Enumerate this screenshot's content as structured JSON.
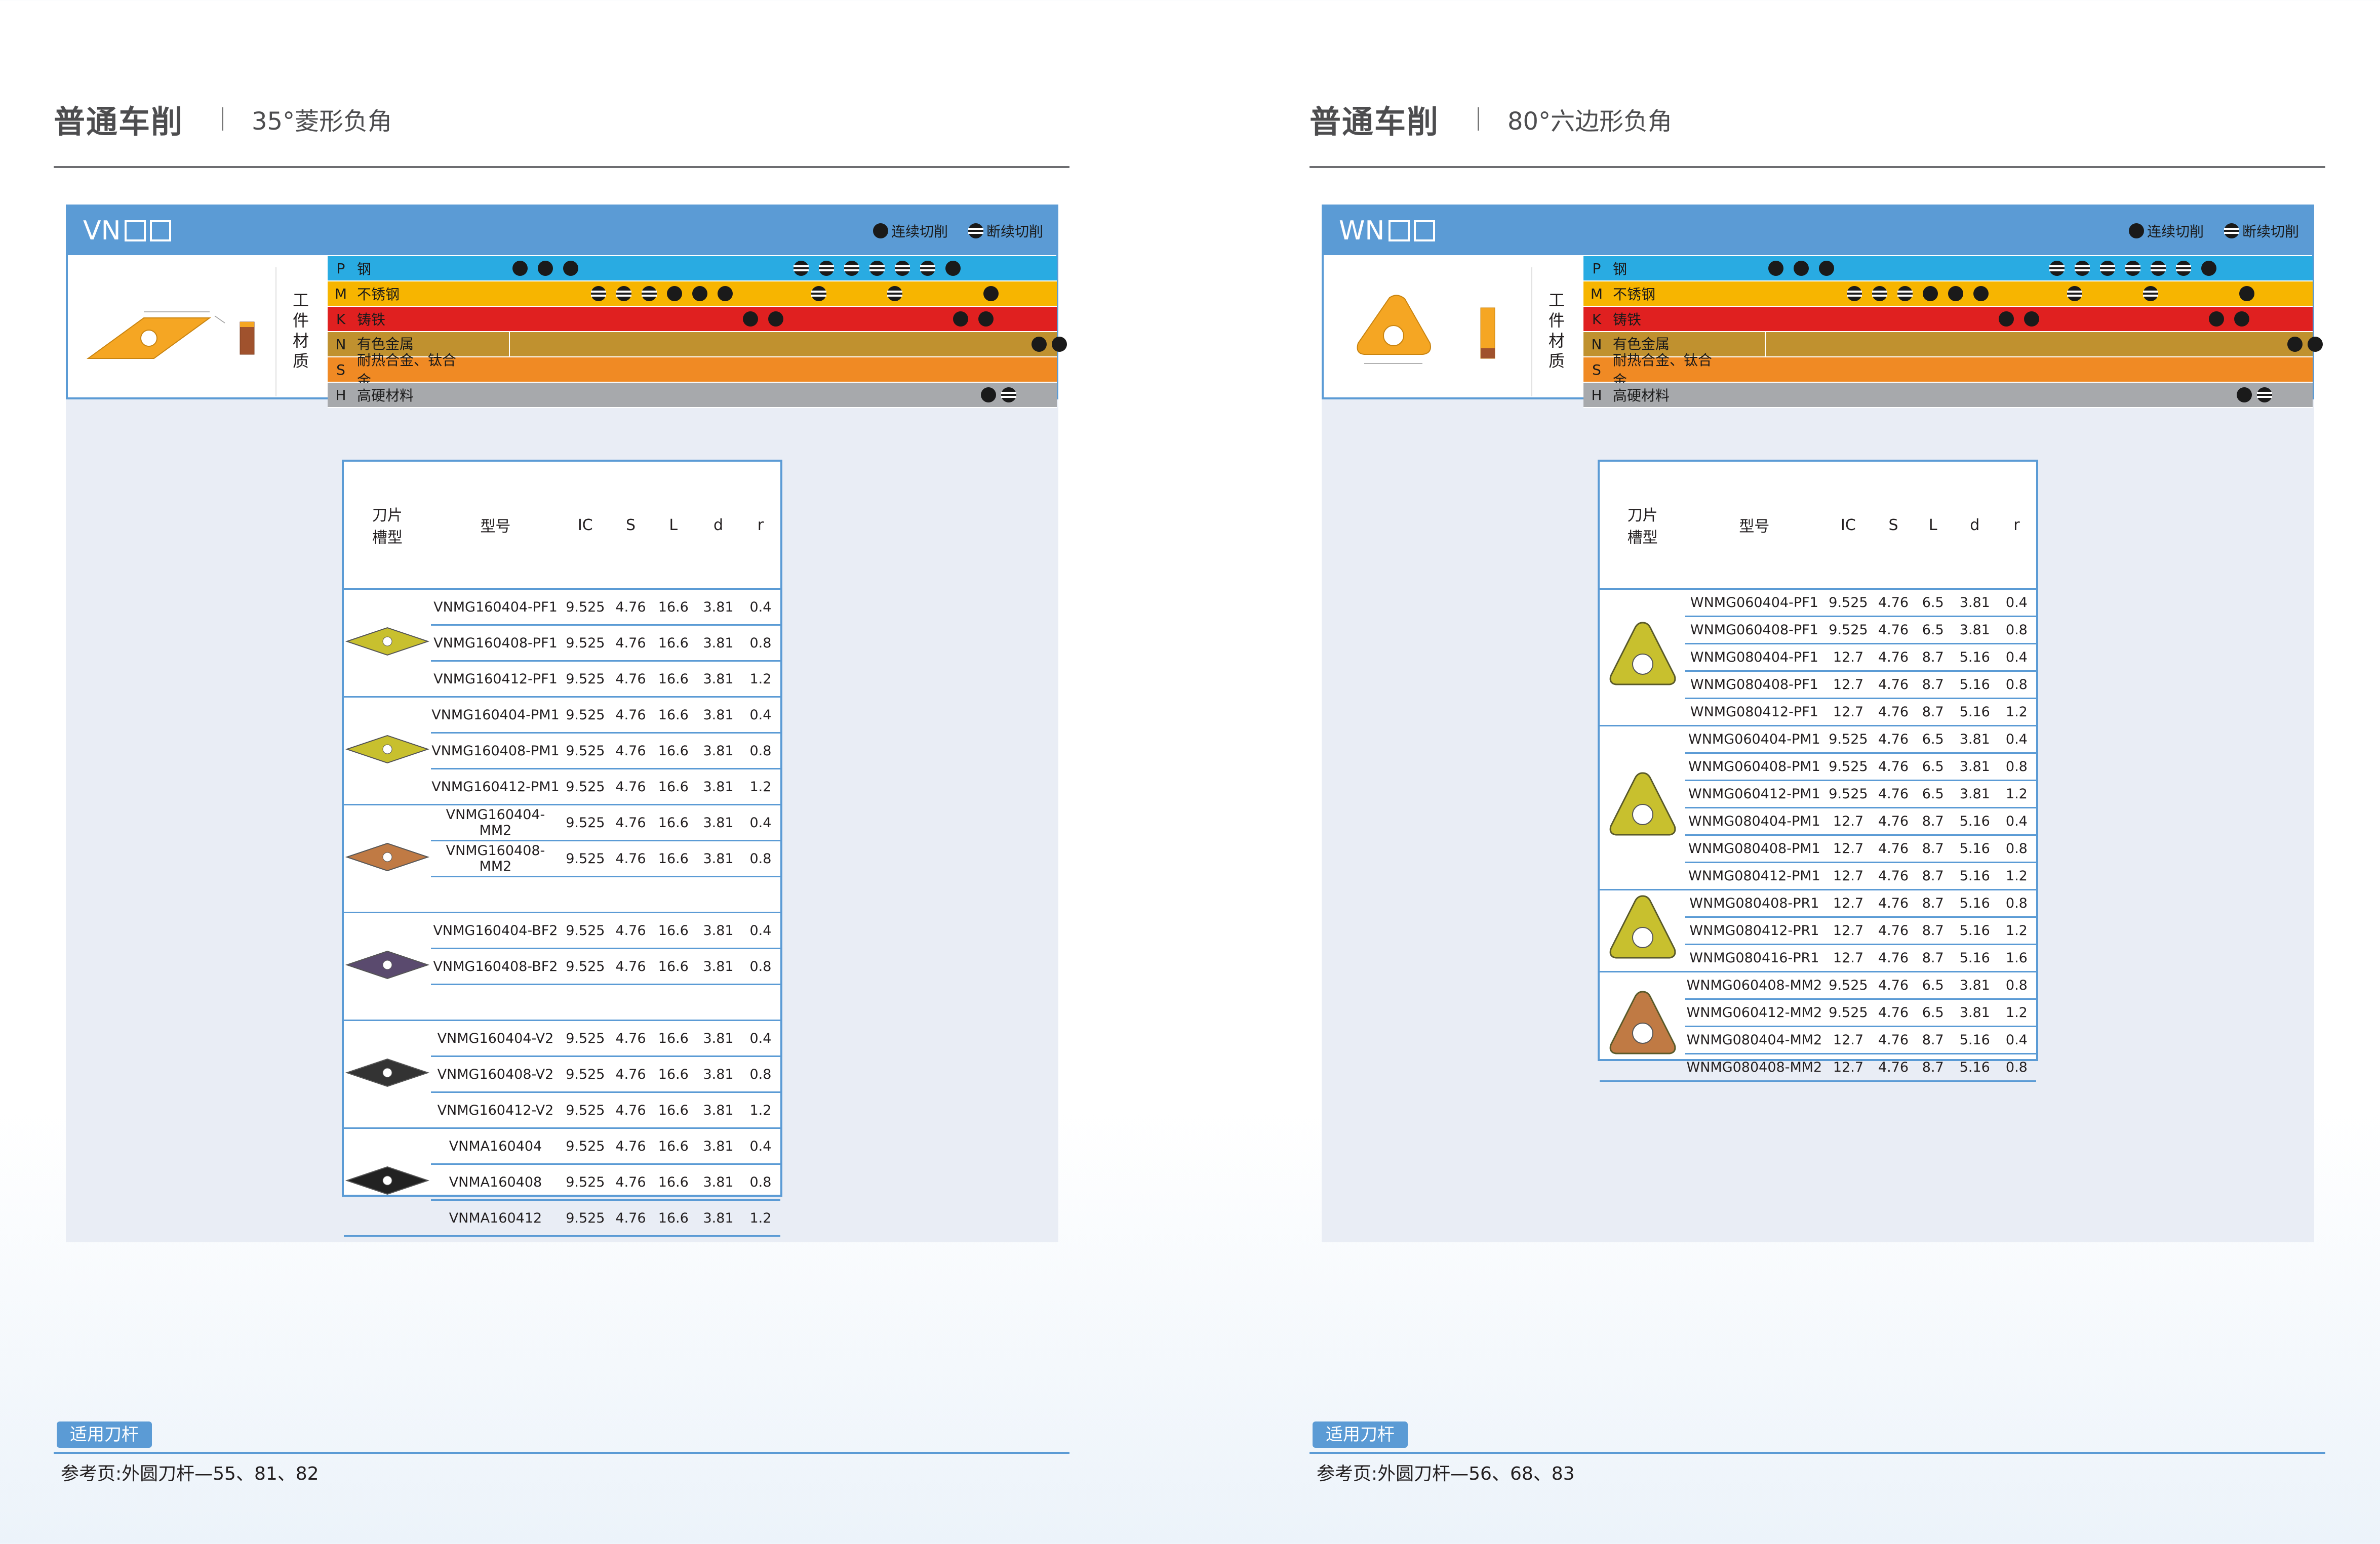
{
  "left": {
    "header": {
      "title": "普通车削",
      "subtitle": "35°菱形负角"
    },
    "code": "VN",
    "legend": {
      "continuous": "连续切削",
      "interrupted": "断续切削"
    },
    "side_label": "工件材质",
    "materials": [
      {
        "key": "P",
        "name": "钢",
        "color": "#29abe2"
      },
      {
        "key": "M",
        "name": "不锈钢",
        "color": "#f7b500"
      },
      {
        "key": "K",
        "name": "铸铁",
        "color": "#e02020"
      },
      {
        "key": "N",
        "name": "有色金属",
        "color": "#c0912f"
      },
      {
        "key": "S",
        "name": "耐热合金、钛合金",
        "color": "#f08a24"
      },
      {
        "key": "H",
        "name": "高硬材料",
        "color": "#a7a9ac"
      }
    ],
    "table": {
      "headers": {
        "groove": "刀片\n槽型",
        "model": "型号",
        "ic": "IC",
        "s": "S",
        "l": "L",
        "d": "d",
        "r": "r"
      },
      "groups": [
        {
          "insert_color": "#c8c02e",
          "rows": [
            [
              "VNMG160404-PF1",
              "9.525",
              "4.76",
              "16.6",
              "3.81",
              "0.4"
            ],
            [
              "VNMG160408-PF1",
              "9.525",
              "4.76",
              "16.6",
              "3.81",
              "0.8"
            ],
            [
              "VNMG160412-PF1",
              "9.525",
              "4.76",
              "16.6",
              "3.81",
              "1.2"
            ]
          ]
        },
        {
          "insert_color": "#c8c02e",
          "rows": [
            [
              "VNMG160404-PM1",
              "9.525",
              "4.76",
              "16.6",
              "3.81",
              "0.4"
            ],
            [
              "VNMG160408-PM1",
              "9.525",
              "4.76",
              "16.6",
              "3.81",
              "0.8"
            ],
            [
              "VNMG160412-PM1",
              "9.525",
              "4.76",
              "16.6",
              "3.81",
              "1.2"
            ]
          ]
        },
        {
          "insert_color": "#c07a44",
          "rows": [
            [
              "VNMG160404-MM2",
              "9.525",
              "4.76",
              "16.6",
              "3.81",
              "0.4"
            ],
            [
              "VNMG160408-MM2",
              "9.525",
              "4.76",
              "16.6",
              "3.81",
              "0.8"
            ],
            [
              "",
              "",
              "",
              "",
              "",
              ""
            ]
          ]
        },
        {
          "insert_color": "#5a4a6e",
          "rows": [
            [
              "VNMG160404-BF2",
              "9.525",
              "4.76",
              "16.6",
              "3.81",
              "0.4"
            ],
            [
              "VNMG160408-BF2",
              "9.525",
              "4.76",
              "16.6",
              "3.81",
              "0.8"
            ],
            [
              "",
              "",
              "",
              "",
              "",
              ""
            ]
          ]
        },
        {
          "insert_color": "#333333",
          "rows": [
            [
              "VNMG160404-V2",
              "9.525",
              "4.76",
              "16.6",
              "3.81",
              "0.4"
            ],
            [
              "VNMG160408-V2",
              "9.525",
              "4.76",
              "16.6",
              "3.81",
              "0.8"
            ],
            [
              "VNMG160412-V2",
              "9.525",
              "4.76",
              "16.6",
              "3.81",
              "1.2"
            ]
          ]
        },
        {
          "insert_color": "#222222",
          "rows": [
            [
              "VNMA160404",
              "9.525",
              "4.76",
              "16.6",
              "3.81",
              "0.4"
            ],
            [
              "VNMA160408",
              "9.525",
              "4.76",
              "16.6",
              "3.81",
              "0.8"
            ],
            [
              "VNMA160412",
              "9.525",
              "4.76",
              "16.6",
              "3.81",
              "1.2"
            ]
          ]
        }
      ]
    },
    "footer": {
      "button": "适用刀杆",
      "ref": "参考页:外圆刀杆—55、81、82"
    }
  },
  "right": {
    "header": {
      "title": "普通车削",
      "subtitle": "80°六边形负角"
    },
    "code": "WN",
    "legend": {
      "continuous": "连续切削",
      "interrupted": "断续切削"
    },
    "side_label": "工件材质",
    "materials": [
      {
        "key": "P",
        "name": "钢",
        "color": "#29abe2"
      },
      {
        "key": "M",
        "name": "不锈钢",
        "color": "#f7b500"
      },
      {
        "key": "K",
        "name": "铸铁",
        "color": "#e02020"
      },
      {
        "key": "N",
        "name": "有色金属",
        "color": "#c0912f"
      },
      {
        "key": "S",
        "name": "耐热合金、钛合金",
        "color": "#f08a24"
      },
      {
        "key": "H",
        "name": "高硬材料",
        "color": "#a7a9ac"
      }
    ],
    "table": {
      "headers": {
        "groove": "刀片\n槽型",
        "model": "型号",
        "ic": "IC",
        "s": "S",
        "l": "L",
        "d": "d",
        "r": "r"
      },
      "groups": [
        {
          "insert_color": "#c8c02e",
          "rows": [
            [
              "WNMG060404-PF1",
              "9.525",
              "4.76",
              "6.5",
              "3.81",
              "0.4"
            ],
            [
              "WNMG060408-PF1",
              "9.525",
              "4.76",
              "6.5",
              "3.81",
              "0.8"
            ],
            [
              "WNMG080404-PF1",
              "12.7",
              "4.76",
              "8.7",
              "5.16",
              "0.4"
            ],
            [
              "WNMG080408-PF1",
              "12.7",
              "4.76",
              "8.7",
              "5.16",
              "0.8"
            ],
            [
              "WNMG080412-PF1",
              "12.7",
              "4.76",
              "8.7",
              "5.16",
              "1.2"
            ]
          ]
        },
        {
          "insert_color": "#c8c02e",
          "rows": [
            [
              "WNMG060404-PM1",
              "9.525",
              "4.76",
              "6.5",
              "3.81",
              "0.4"
            ],
            [
              "WNMG060408-PM1",
              "9.525",
              "4.76",
              "6.5",
              "3.81",
              "0.8"
            ],
            [
              "WNMG060412-PM1",
              "9.525",
              "4.76",
              "6.5",
              "3.81",
              "1.2"
            ],
            [
              "WNMG080404-PM1",
              "12.7",
              "4.76",
              "8.7",
              "5.16",
              "0.4"
            ],
            [
              "WNMG080408-PM1",
              "12.7",
              "4.76",
              "8.7",
              "5.16",
              "0.8"
            ],
            [
              "WNMG080412-PM1",
              "12.7",
              "4.76",
              "8.7",
              "5.16",
              "1.2"
            ]
          ]
        },
        {
          "insert_color": "#c8c02e",
          "rows": [
            [
              "WNMG080408-PR1",
              "12.7",
              "4.76",
              "8.7",
              "5.16",
              "0.8"
            ],
            [
              "WNMG080412-PR1",
              "12.7",
              "4.76",
              "8.7",
              "5.16",
              "1.2"
            ],
            [
              "WNMG080416-PR1",
              "12.7",
              "4.76",
              "8.7",
              "5.16",
              "1.6"
            ]
          ]
        },
        {
          "insert_color": "#c07a44",
          "rows": [
            [
              "WNMG060408-MM2",
              "9.525",
              "4.76",
              "6.5",
              "3.81",
              "0.8"
            ],
            [
              "WNMG060412-MM2",
              "9.525",
              "4.76",
              "6.5",
              "3.81",
              "1.2"
            ],
            [
              "WNMG080404-MM2",
              "12.7",
              "4.76",
              "8.7",
              "5.16",
              "0.4"
            ],
            [
              "WNMG080408-MM2",
              "12.7",
              "4.76",
              "8.7",
              "5.16",
              "0.8"
            ]
          ]
        }
      ]
    },
    "footer": {
      "button": "适用刀杆",
      "ref": "参考页:外圆刀杆—56、68、83"
    }
  }
}
